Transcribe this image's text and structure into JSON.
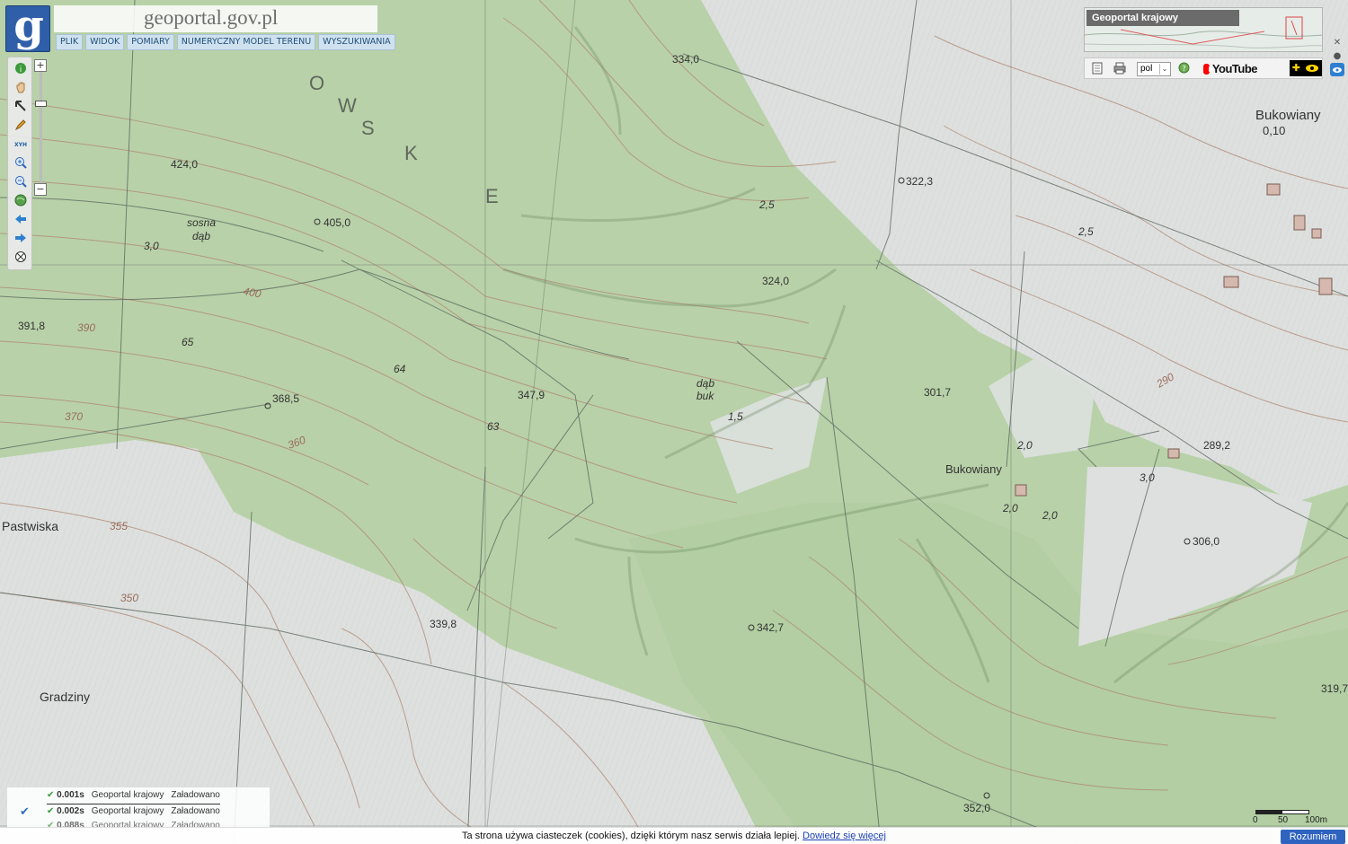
{
  "header": {
    "site_title": "geoportal.gov.pl",
    "logo_letter": "g",
    "menu": [
      "PLIK",
      "WIDOK",
      "POMIARY",
      "NUMERYCZNY MODEL TERENU",
      "WYSZUKIWANIA"
    ]
  },
  "toolbar": {
    "tools": [
      {
        "name": "info-icon",
        "glyph": "i"
      },
      {
        "name": "pan-hand-icon",
        "glyph": "✋"
      },
      {
        "name": "select-arrow-icon",
        "glyph": "↖"
      },
      {
        "name": "pencil-icon",
        "glyph": "✎"
      },
      {
        "name": "xyh-icon",
        "glyph": "XYH"
      },
      {
        "name": "zoom-in-icon",
        "glyph": "⊕"
      },
      {
        "name": "zoom-out-icon",
        "glyph": "⊖"
      },
      {
        "name": "globe-icon",
        "glyph": "●"
      },
      {
        "name": "back-arrow-icon",
        "glyph": "⬅"
      },
      {
        "name": "forward-arrow-icon",
        "glyph": "➡"
      },
      {
        "name": "full-extent-icon",
        "glyph": "⊗"
      }
    ],
    "zoom_in": "+",
    "zoom_out": "−"
  },
  "overview": {
    "label": "Geoportal krajowy"
  },
  "right_panel": {
    "language": "pol",
    "youtube_label": "YouTube",
    "colors": {
      "youtube": "#ff0000",
      "accessibility": "#ffd400"
    }
  },
  "map": {
    "labels": {
      "bukowiany_village": "Bukowiany",
      "bukowiany_village_sub": "0,10",
      "bukowiany_mid": "Bukowiany",
      "pastwiska": "Pastwiska",
      "gradziny": "Gradziny",
      "sosna": "sosna",
      "dab1": "dąb",
      "dab2": "dąb",
      "buk": "buk",
      "forest_65": "65",
      "forest_64": "64",
      "forest_63": "63",
      "val_3_0": "3,0",
      "val_2_5": "2,5",
      "val_1_5": "1,5",
      "val_2_5b": "2,5",
      "val_3_0b": "3,0",
      "val_2_0": "2,0",
      "val_2_0b": "2,0",
      "val_2_0c": "2,0",
      "big_e": "E",
      "big_k": "K",
      "big_s": "S",
      "big_w": "W",
      "big_o": "O"
    },
    "spot_heights": [
      "334,0",
      "322,3",
      "424,0",
      "405,0",
      "324,0",
      "391,8",
      "368,5",
      "347,9",
      "301,7",
      "289,2",
      "306,0",
      "339,8",
      "342,7",
      "352,0",
      "319,7"
    ],
    "contour_labels": [
      "400",
      "390",
      "370",
      "360",
      "355",
      "350",
      "290"
    ],
    "colors": {
      "forest": "#b5cfa6",
      "open": "#dcdedc",
      "contour": "#b08673",
      "road": "#5f6a63"
    }
  },
  "layers": {
    "rows": [
      {
        "time": "0.001s",
        "source": "Geoportal krajowy",
        "status": "Załadowano"
      },
      {
        "time": "0.002s",
        "source": "Geoportal krajowy",
        "status": "Załadowano"
      },
      {
        "time": "0.088s",
        "source": "Geoportal krajowy",
        "status": "Załadowano"
      }
    ]
  },
  "scale": {
    "zero": "0",
    "mid": "50",
    "end": "100m"
  },
  "cookie": {
    "text": "Ta strona używa ciasteczek (cookies), dzięki którym nasz serwis działa lepiej.",
    "link": "Dowiedz się więcej",
    "button": "Rozumiem"
  }
}
